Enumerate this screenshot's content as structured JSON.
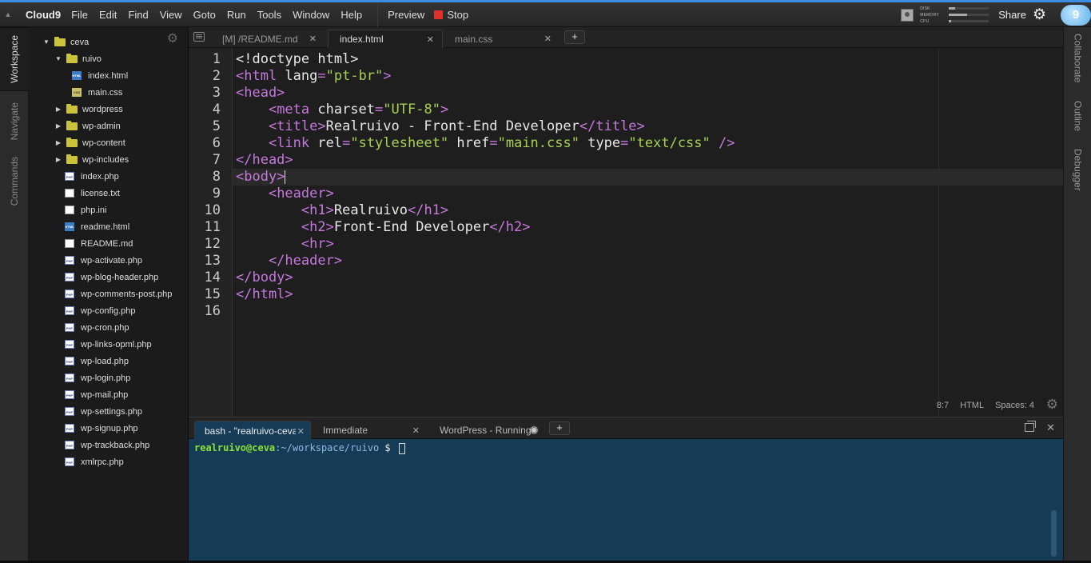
{
  "menubar": {
    "brand": "Cloud9",
    "items": [
      "File",
      "Edit",
      "Find",
      "View",
      "Goto",
      "Run",
      "Tools",
      "Window",
      "Help"
    ],
    "preview": "Preview",
    "stop": "Stop",
    "stats": [
      {
        "label": "DISK",
        "level": 0.15
      },
      {
        "label": "MEMORY",
        "level": 0.45
      },
      {
        "label": "CPU",
        "level": 0.05
      }
    ],
    "share": "Share",
    "logo_glyph": "9",
    "accent_color": "#3a8de0"
  },
  "left_rail": {
    "tabs": [
      "Workspace",
      "Navigate",
      "Commands"
    ]
  },
  "right_rail": {
    "tabs": [
      "Collaborate",
      "Outline",
      "Debugger"
    ]
  },
  "tree": {
    "items": [
      {
        "name": "ceva",
        "kind": "folder",
        "expanded": true,
        "depth": 0
      },
      {
        "name": "ruivo",
        "kind": "folder",
        "expanded": true,
        "depth": 1
      },
      {
        "name": "index.html",
        "kind": "html",
        "depth": 2
      },
      {
        "name": "main.css",
        "kind": "css",
        "depth": 2
      },
      {
        "name": "wordpress",
        "kind": "folder",
        "expanded": false,
        "depth": 1
      },
      {
        "name": "wp-admin",
        "kind": "folder",
        "expanded": false,
        "depth": 1
      },
      {
        "name": "wp-content",
        "kind": "folder",
        "expanded": false,
        "depth": 1
      },
      {
        "name": "wp-includes",
        "kind": "folder",
        "expanded": false,
        "depth": 1
      },
      {
        "name": "index.php",
        "kind": "php",
        "depth": 1
      },
      {
        "name": "license.txt",
        "kind": "txt",
        "depth": 1
      },
      {
        "name": "php.ini",
        "kind": "txt",
        "depth": 1
      },
      {
        "name": "readme.html",
        "kind": "html",
        "depth": 1
      },
      {
        "name": "README.md",
        "kind": "txt",
        "depth": 1
      },
      {
        "name": "wp-activate.php",
        "kind": "php",
        "depth": 1
      },
      {
        "name": "wp-blog-header.php",
        "kind": "php",
        "depth": 1
      },
      {
        "name": "wp-comments-post.php",
        "kind": "php",
        "depth": 1
      },
      {
        "name": "wp-config.php",
        "kind": "php",
        "depth": 1
      },
      {
        "name": "wp-cron.php",
        "kind": "php",
        "depth": 1
      },
      {
        "name": "wp-links-opml.php",
        "kind": "php",
        "depth": 1
      },
      {
        "name": "wp-load.php",
        "kind": "php",
        "depth": 1
      },
      {
        "name": "wp-login.php",
        "kind": "php",
        "depth": 1
      },
      {
        "name": "wp-mail.php",
        "kind": "php",
        "depth": 1
      },
      {
        "name": "wp-settings.php",
        "kind": "php",
        "depth": 1
      },
      {
        "name": "wp-signup.php",
        "kind": "php",
        "depth": 1
      },
      {
        "name": "wp-trackback.php",
        "kind": "php",
        "depth": 1
      },
      {
        "name": "xmlrpc.php",
        "kind": "php",
        "depth": 1
      }
    ]
  },
  "editor_tabs": [
    {
      "label": "[M] /README.md",
      "active": false
    },
    {
      "label": "index.html",
      "active": true
    },
    {
      "label": "main.css",
      "active": false
    }
  ],
  "editor": {
    "active_line": 8,
    "lines": [
      [
        [
          "a",
          "<!doctype html>"
        ]
      ],
      [
        [
          "t",
          "<html "
        ],
        [
          "a",
          "lang"
        ],
        [
          "t",
          "="
        ],
        [
          "s",
          "\"pt-br\""
        ],
        [
          "t",
          ">"
        ]
      ],
      [
        [
          "t",
          "<head>"
        ]
      ],
      [
        [
          "a",
          "    "
        ],
        [
          "t",
          "<meta "
        ],
        [
          "a",
          "charset"
        ],
        [
          "t",
          "="
        ],
        [
          "s",
          "\"UTF-8\""
        ],
        [
          "t",
          ">"
        ]
      ],
      [
        [
          "a",
          "    "
        ],
        [
          "t",
          "<title>"
        ],
        [
          "a",
          "Realruivo - Front-End Developer"
        ],
        [
          "t",
          "</title>"
        ]
      ],
      [
        [
          "a",
          "    "
        ],
        [
          "t",
          "<link "
        ],
        [
          "a",
          "rel"
        ],
        [
          "t",
          "="
        ],
        [
          "s",
          "\"stylesheet\""
        ],
        [
          "a",
          " href"
        ],
        [
          "t",
          "="
        ],
        [
          "s",
          "\"main.css\""
        ],
        [
          "a",
          " type"
        ],
        [
          "t",
          "="
        ],
        [
          "s",
          "\"text/css\""
        ],
        [
          "t",
          " />"
        ]
      ],
      [
        [
          "t",
          "</head>"
        ]
      ],
      [
        [
          "t",
          "<body>"
        ]
      ],
      [
        [
          "a",
          "    "
        ],
        [
          "t",
          "<header>"
        ]
      ],
      [
        [
          "a",
          "        "
        ],
        [
          "t",
          "<h1>"
        ],
        [
          "a",
          "Realruivo"
        ],
        [
          "t",
          "</h1>"
        ]
      ],
      [
        [
          "a",
          "        "
        ],
        [
          "t",
          "<h2>"
        ],
        [
          "a",
          "Front-End Developer"
        ],
        [
          "t",
          "</h2>"
        ]
      ],
      [
        [
          "a",
          "        "
        ],
        [
          "t",
          "<hr>"
        ]
      ],
      [
        [
          "a",
          "    "
        ],
        [
          "t",
          "</header>"
        ]
      ],
      [
        [
          "t",
          "</body>"
        ]
      ],
      [
        [
          "t",
          "</html>"
        ]
      ],
      []
    ],
    "status": {
      "position": "8:7",
      "mode": "HTML",
      "indent": "Spaces: 4"
    }
  },
  "console_tabs": [
    {
      "label": "bash - \"realruivo-ceva\"",
      "active": true
    },
    {
      "label": "Immediate",
      "active": false
    },
    {
      "label": "WordPress - Running",
      "active": false
    }
  ],
  "terminal": {
    "user": "realruivo@ceva",
    "path": ":~/workspace/ruivo",
    "prompt": " $ "
  }
}
